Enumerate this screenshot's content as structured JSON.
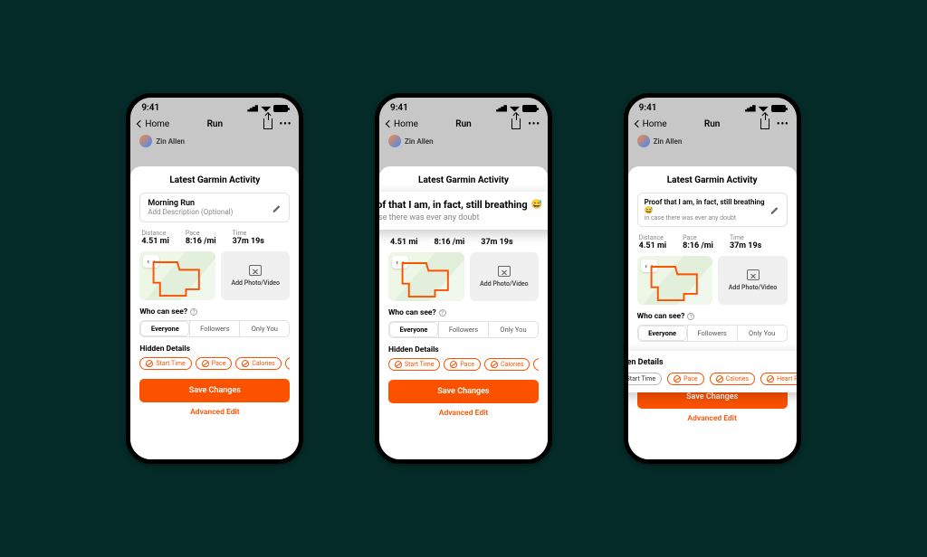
{
  "statusbar": {
    "time": "9:41"
  },
  "navbar": {
    "back": "Home",
    "title": "Run"
  },
  "peek_name": "Zin Allen",
  "sheet": {
    "header": "Latest Garmin Activity",
    "title_default": "Morning Run",
    "desc_placeholder": "Add Description (Optional)",
    "title_filled": "Proof that I am, in fact, still breathing",
    "desc_filled": "in case there was ever any doubt",
    "emoji": "😅",
    "stats": {
      "distance": {
        "label": "Distance",
        "value": "4.51 mi"
      },
      "pace": {
        "label": "Pace",
        "value": "8:16 /mi"
      },
      "time": {
        "label": "Time",
        "value": "37m 19s"
      }
    },
    "add_media": "Add Photo/Video",
    "visibility": {
      "label": "Who can see?",
      "options": [
        "Everyone",
        "Followers",
        "Only You"
      ],
      "active": "Everyone"
    },
    "hidden": {
      "label": "Hidden Details",
      "chips_short": [
        "Start Time",
        "Pace",
        "Calories",
        "Hea"
      ],
      "chips_full": [
        "Start Time",
        "Pace",
        "Calories",
        "Heart Rate"
      ]
    },
    "save": "Save Changes",
    "advanced": "Advanced Edit"
  }
}
